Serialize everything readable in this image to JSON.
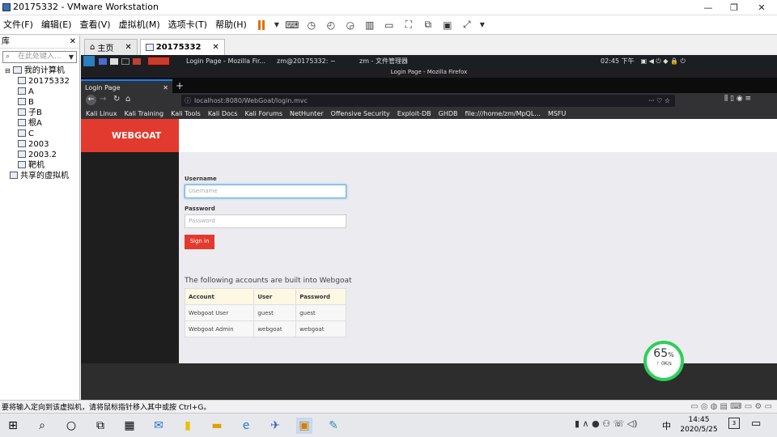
{
  "window": {
    "title": "20175332 - VMware Workstation"
  },
  "menu": [
    "文件(F)",
    "编辑(E)",
    "查看(V)",
    "虚拟机(M)",
    "选项卡(T)",
    "帮助(H)"
  ],
  "library": {
    "title": "库",
    "search_placeholder": "在此处键入...",
    "tree": [
      "我的计算机",
      "20175332",
      "A",
      "B",
      "子B",
      "根A",
      "C",
      "2003",
      "2003.2",
      "靶机",
      "共享的虚拟机"
    ]
  },
  "tabs": {
    "home": "主页",
    "vm": "20175332"
  },
  "kali": {
    "task1": "Login Page - Mozilla Fir...",
    "task2": "zm@20175332: ~",
    "task3": "zm - 文件管理器",
    "clock": "02:45 下午"
  },
  "firefox": {
    "window_title": "Login Page - Mozilla Firefox",
    "tab_title": "Login Page",
    "url": "localhost:8080/WebGoat/login.mvc",
    "bookmarks": [
      "Kali Linux",
      "Kali Training",
      "Kali Tools",
      "Kali Docs",
      "Kali Forums",
      "NetHunter",
      "Offensive Security",
      "Exploit-DB",
      "GHDB",
      "file:///home/zm/MpQL...",
      "MSFU"
    ]
  },
  "webgoat": {
    "logo": "WEBGOAT",
    "username_label": "Username",
    "username_placeholder": "Username",
    "password_label": "Password",
    "password_placeholder": "Password",
    "signin": "Sign in",
    "accounts_title": "The following accounts are built into Webgoat",
    "table": {
      "headers": [
        "Account",
        "User",
        "Password"
      ],
      "rows": [
        [
          "Webgoat User",
          "guest",
          "guest"
        ],
        [
          "Webgoat Admin",
          "webgoat",
          "webgoat"
        ]
      ]
    }
  },
  "speed": {
    "percent": "65",
    "pct_sign": "%",
    "rate": "0K/s",
    "arrow": "↑"
  },
  "status": "要将输入定向到该虚拟机，请将鼠标指针移入其中或按 Ctrl+G。",
  "taskbar": {
    "ime": "中",
    "time": "14:45",
    "date": "2020/5/25",
    "badge": "3"
  },
  "colors": {
    "accent": "#e33a2f",
    "vm_bg": "#2d2d2d",
    "ring": "#2fcf5a"
  }
}
